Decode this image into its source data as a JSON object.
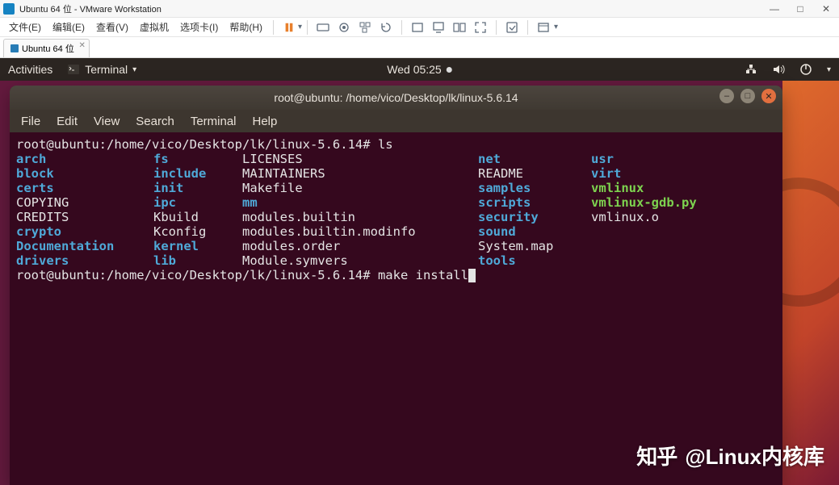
{
  "vmware": {
    "title": "Ubuntu 64 位 - VMware Workstation",
    "menu": [
      "文件(E)",
      "编辑(E)",
      "查看(V)",
      "虚拟机",
      "选项卡(I)",
      "帮助(H)"
    ],
    "tab_label": "Ubuntu 64 位"
  },
  "gnome": {
    "activities": "Activities",
    "app_name": "Terminal",
    "clock": "Wed 05:25"
  },
  "terminal": {
    "title": "root@ubuntu: /home/vico/Desktop/lk/linux-5.6.14",
    "menu": [
      "File",
      "Edit",
      "View",
      "Search",
      "Terminal",
      "Help"
    ],
    "prompt1": "root@ubuntu:/home/vico/Desktop/lk/linux-5.6.14#",
    "cmd1": "ls",
    "ls": {
      "rows": [
        [
          {
            "t": "arch",
            "c": "dir"
          },
          {
            "t": "fs",
            "c": "dir"
          },
          {
            "t": "LICENSES",
            "c": "plain"
          },
          {
            "t": "net",
            "c": "dir"
          },
          {
            "t": "usr",
            "c": "dir"
          }
        ],
        [
          {
            "t": "block",
            "c": "dir"
          },
          {
            "t": "include",
            "c": "dir"
          },
          {
            "t": "MAINTAINERS",
            "c": "plain"
          },
          {
            "t": "README",
            "c": "plain"
          },
          {
            "t": "virt",
            "c": "dir"
          }
        ],
        [
          {
            "t": "certs",
            "c": "dir"
          },
          {
            "t": "init",
            "c": "dir"
          },
          {
            "t": "Makefile",
            "c": "plain"
          },
          {
            "t": "samples",
            "c": "dir"
          },
          {
            "t": "vmlinux",
            "c": "exe"
          }
        ],
        [
          {
            "t": "COPYING",
            "c": "plain"
          },
          {
            "t": "ipc",
            "c": "dir"
          },
          {
            "t": "mm",
            "c": "dir"
          },
          {
            "t": "scripts",
            "c": "dir"
          },
          {
            "t": "vmlinux-gdb.py",
            "c": "exe"
          }
        ],
        [
          {
            "t": "CREDITS",
            "c": "plain"
          },
          {
            "t": "Kbuild",
            "c": "plain"
          },
          {
            "t": "modules.builtin",
            "c": "plain"
          },
          {
            "t": "security",
            "c": "dir"
          },
          {
            "t": "vmlinux.o",
            "c": "plain"
          }
        ],
        [
          {
            "t": "crypto",
            "c": "dir"
          },
          {
            "t": "Kconfig",
            "c": "plain"
          },
          {
            "t": "modules.builtin.modinfo",
            "c": "plain"
          },
          {
            "t": "sound",
            "c": "dir"
          },
          {
            "t": "",
            "c": "plain"
          }
        ],
        [
          {
            "t": "Documentation",
            "c": "dir"
          },
          {
            "t": "kernel",
            "c": "dir"
          },
          {
            "t": "modules.order",
            "c": "plain"
          },
          {
            "t": "System.map",
            "c": "plain"
          },
          {
            "t": "",
            "c": "plain"
          }
        ],
        [
          {
            "t": "drivers",
            "c": "dir"
          },
          {
            "t": "lib",
            "c": "dir"
          },
          {
            "t": "Module.symvers",
            "c": "plain"
          },
          {
            "t": "tools",
            "c": "dir"
          },
          {
            "t": "",
            "c": "plain"
          }
        ]
      ]
    },
    "prompt2": "root@ubuntu:/home/vico/Desktop/lk/linux-5.6.14#",
    "cmd2": "make install"
  },
  "watermark": {
    "logo": "知乎",
    "text": "@Linux内核库"
  }
}
